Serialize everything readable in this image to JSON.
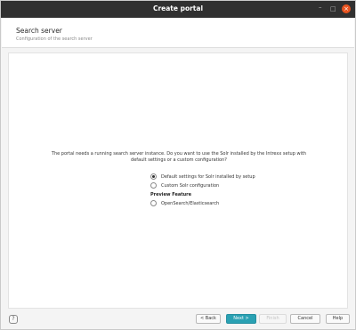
{
  "window": {
    "title": "Create portal",
    "minimize": "–",
    "maximize": "□",
    "close": "×"
  },
  "header": {
    "title": "Search server",
    "subtitle": "Configuration of the search server"
  },
  "main": {
    "intro_line1": "The portal needs a running search server instance. Do you want to use the Solr installed by the Intrexx setup with",
    "intro_line2": "default settings or a custom configuration?",
    "options": [
      {
        "label": "Default settings for Solr installed by setup",
        "checked": true
      },
      {
        "label": "Custom Solr configuration",
        "checked": false
      }
    ],
    "preview_section": "Preview Feature",
    "preview_option": {
      "label": "OpenSearch/Elasticsearch",
      "checked": false
    }
  },
  "footer": {
    "help_icon": "?",
    "back": "< Back",
    "next": "Next >",
    "finish": "Finish",
    "cancel": "Cancel",
    "help": "Help"
  }
}
